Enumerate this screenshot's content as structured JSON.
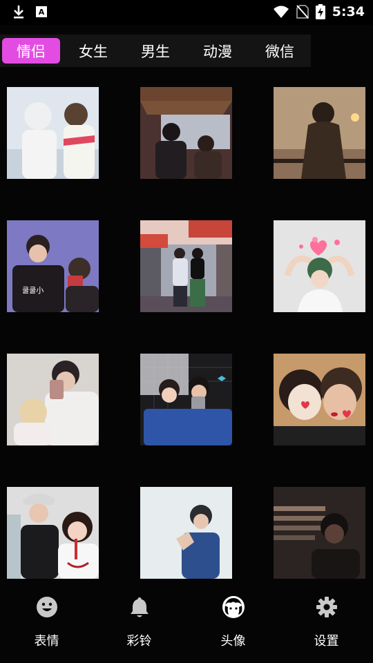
{
  "status_bar": {
    "time": "5:34",
    "badge_letter": "A"
  },
  "tabs": [
    {
      "label": "情侣",
      "active": true
    },
    {
      "label": "女生",
      "active": false
    },
    {
      "label": "男生",
      "active": false
    },
    {
      "label": "动漫",
      "active": false
    },
    {
      "label": "微信",
      "active": false
    }
  ],
  "thumbnails": [
    {
      "name": "avatar-couple-1"
    },
    {
      "name": "avatar-couple-2"
    },
    {
      "name": "avatar-couple-3"
    },
    {
      "name": "avatar-couple-4",
      "shirt_text": "쿨쿨小"
    },
    {
      "name": "avatar-couple-5"
    },
    {
      "name": "avatar-couple-6"
    },
    {
      "name": "avatar-couple-7"
    },
    {
      "name": "avatar-couple-8"
    },
    {
      "name": "avatar-couple-9"
    },
    {
      "name": "avatar-couple-10"
    },
    {
      "name": "avatar-couple-11"
    },
    {
      "name": "avatar-couple-12"
    }
  ],
  "bottom_nav": [
    {
      "label": "表情",
      "icon": "smiley-icon",
      "active": false
    },
    {
      "label": "彩铃",
      "icon": "bell-icon",
      "active": false
    },
    {
      "label": "头像",
      "icon": "avatar-face-icon",
      "active": true
    },
    {
      "label": "设置",
      "icon": "gear-icon",
      "active": false
    }
  ],
  "colors": {
    "accent": "#e34ce3",
    "background": "#050505",
    "tabbar": "#141414"
  }
}
